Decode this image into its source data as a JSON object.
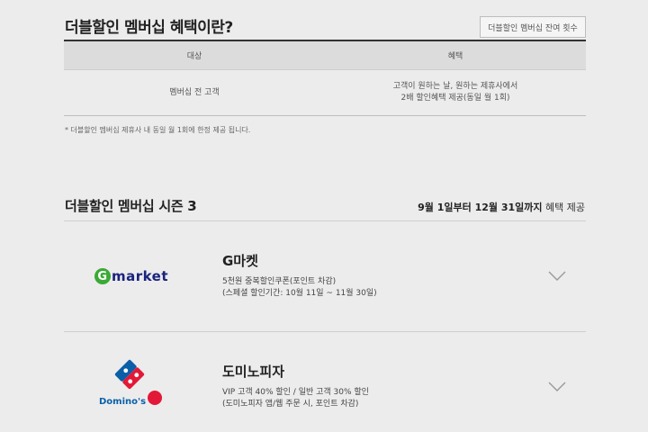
{
  "membership_info": {
    "title": "더블할인 멤버십 혜택이란?",
    "remain_button": "더블할인 멤버십 잔여 횟수",
    "table": {
      "headers": [
        "대상",
        "혜택"
      ],
      "rows": [
        {
          "target": "멤버십 전 고객",
          "benefit_lines": [
            "고객이 원하는 날, 원하는 제휴사에서",
            "2배 할인혜택 제공(동일 월 1회)"
          ]
        }
      ]
    },
    "footnote": "* 더블할인 멤버십 제휴사 내 동일 월 1회에 한정 제공 됩니다."
  },
  "season": {
    "title": "더블할인 멤버십 시즌 3",
    "period_bold": "9월 1일부터 12월 31일까지",
    "period_rest": " 혜택 제공"
  },
  "partners": [
    {
      "name": "G마켓",
      "logo_g": "G",
      "logo_text": "market",
      "desc_lines": [
        "5천원 중복할인쿠폰(포인트 차감)",
        "(스페셜 할인기간: 10월 11일 ~ 11월 30일)"
      ]
    },
    {
      "name": "도미노피자",
      "logo_text": "Domino's",
      "desc_lines": [
        "VIP 고객 40% 할인 / 일반 고객 30% 할인",
        "(도미노피자 앱/웹 주문 시, 포인트 차감)"
      ]
    }
  ],
  "colors": {
    "gmarket_green": "#3aaa35",
    "gmarket_navy": "#1a237e",
    "dominos_blue": "#0b5fa8",
    "dominos_red": "#e31837"
  }
}
